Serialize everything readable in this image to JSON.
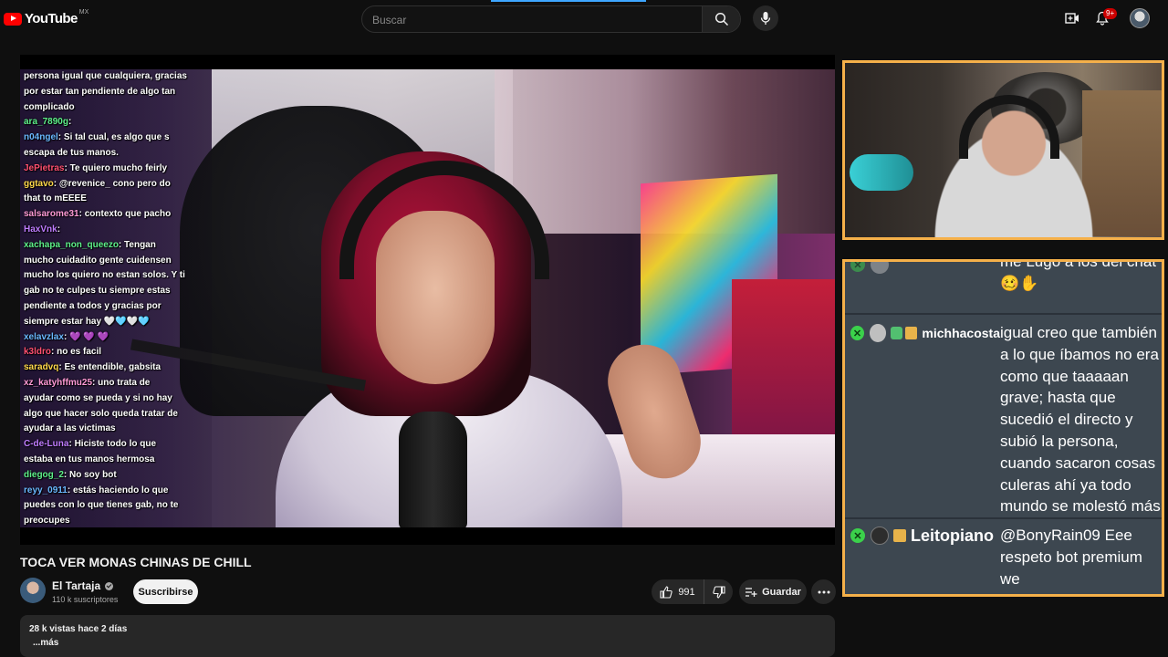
{
  "header": {
    "logo_text": "YouTube",
    "country_code": "MX",
    "search_placeholder": "Buscar",
    "notification_count": "9+",
    "icons": [
      "search-icon",
      "mic-icon",
      "create-icon",
      "bell-icon",
      "avatar"
    ]
  },
  "stream_chat": [
    {
      "user": "",
      "text": "persona igual que cualquiera, gracias"
    },
    {
      "user": "",
      "text": "por estar tan pendiente de algo tan"
    },
    {
      "user": "",
      "text": "complicado"
    },
    {
      "user": "ara_7890g",
      "text": ""
    },
    {
      "user": "n04ngel",
      "text": "Si tal cual, es algo que s"
    },
    {
      "user": "",
      "text": "escapa de tus manos."
    },
    {
      "user": "JePietras",
      "text": "Te quiero mucho feirly"
    },
    {
      "user": "ggtavo",
      "text": "@revenice_ cono pero do"
    },
    {
      "user": "",
      "text": "that to mEEEE"
    },
    {
      "user": "salsarome31",
      "text": "contexto que pacho"
    },
    {
      "user": "HaxVnk",
      "text": ""
    },
    {
      "user": "xachapa_non_queezo",
      "text": "Tengan"
    },
    {
      "user": "",
      "text": "mucho cuidadito gente cuidensen"
    },
    {
      "user": "",
      "text": "mucho los quiero no estan solos. Y ti"
    },
    {
      "user": "",
      "text": "gab no te culpes tu siempre estas"
    },
    {
      "user": "",
      "text": "pendiente a todos y gracias por"
    },
    {
      "user": "",
      "text": "siempre estar hay 🤍🩵🤍🩵"
    },
    {
      "user": "xelavzlax",
      "text": "💜 💜 💜"
    },
    {
      "user": "k3ldro",
      "text": "no es facil"
    },
    {
      "user": "saradvq",
      "text": "Es entendible, gabsita"
    },
    {
      "user": "xz_katyhffmu25",
      "text": "uno trata de"
    },
    {
      "user": "",
      "text": "ayudar como se pueda y si no hay"
    },
    {
      "user": "",
      "text": "algo que hacer solo queda tratar de"
    },
    {
      "user": "",
      "text": "ayudar a las victimas"
    },
    {
      "user": "C-de-Luna",
      "text": "Hiciste todo lo que"
    },
    {
      "user": "",
      "text": "estaba en tus manos hermosa"
    },
    {
      "user": "diegog_2",
      "text": "No soy bot"
    },
    {
      "user": "reyy_0911",
      "text": "estás haciendo lo que"
    },
    {
      "user": "",
      "text": "puedes con lo que tienes gab, no te"
    },
    {
      "user": "",
      "text": "preocupes"
    }
  ],
  "side_chat": {
    "messages": [
      {
        "name": "",
        "text": "me Lugo a los del chat 🥴✋"
      },
      {
        "name": "michhacosta",
        "text": "igual creo que también a lo que íbamos no era como que taaaaan grave; hasta que sucedió el directo y subió la persona, cuando sacaron cosas culeras ahí ya todo mundo se molestó más"
      },
      {
        "name": "Leitopiano",
        "text": "@BonyRain09 Eee respeto bot premium we"
      }
    ]
  },
  "video": {
    "title": "TOCA VER MONAS CHINAS DE CHILL",
    "channel_name": "El Tartaja",
    "subscribers": "110 k suscriptores",
    "subscribe_label": "Suscribirse",
    "likes": "991",
    "save_label": "Guardar",
    "views_date": "28 k vistas  hace 2 días",
    "more_label": "...más"
  },
  "colors": {
    "background": "#0f0f0f",
    "accent": "#ff0000",
    "overlay_border": "#f5b04a",
    "chat_bg": "#3d4750",
    "chat_badge": "#3bd14b"
  }
}
